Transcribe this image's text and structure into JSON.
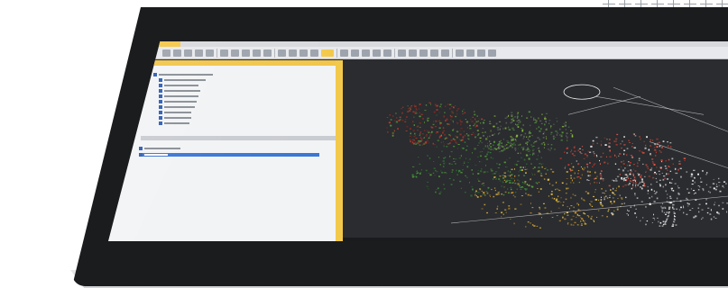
{
  "device": {
    "kind": "monitor-mockup"
  },
  "app": {
    "ribbon_tools": 34,
    "tree_items": [
      {
        "width": 60
      },
      {
        "width": 46
      },
      {
        "width": 38
      },
      {
        "width": 40
      },
      {
        "width": 38
      },
      {
        "width": 36
      },
      {
        "width": 34
      },
      {
        "width": 30
      },
      {
        "width": 30
      },
      {
        "width": 28
      }
    ],
    "prop_items": [
      {
        "width": 40,
        "selected": false
      },
      {
        "width": 26,
        "selected": true
      }
    ]
  },
  "icons": [
    "cross-mark-icon"
  ],
  "colors": {
    "accent": "#f3c94b",
    "selection": "#3a77d6",
    "bezel": "#1b1c1e"
  }
}
